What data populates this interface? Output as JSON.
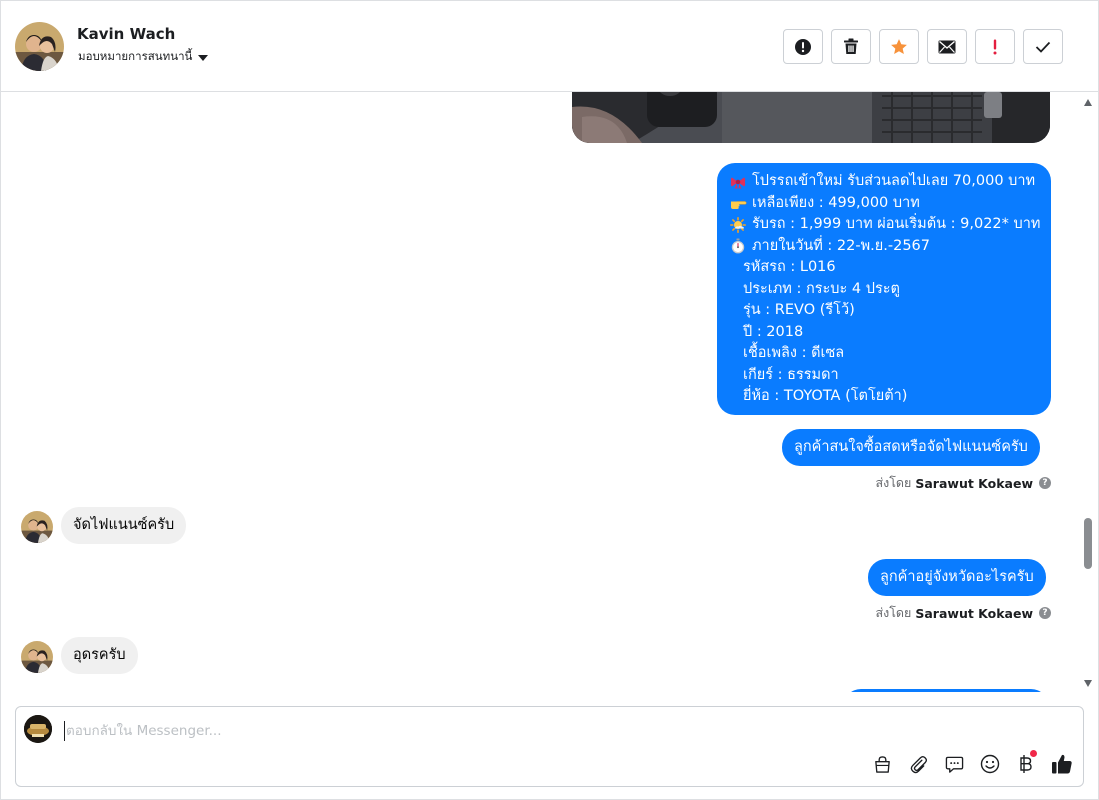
{
  "header": {
    "contact_name": "Kavin Wach",
    "assign_label": "มอบหมายการสนทนานี้",
    "actions": [
      {
        "name": "report-spam-button",
        "icon": "alert-circle-icon"
      },
      {
        "name": "delete-button",
        "icon": "trash-icon"
      },
      {
        "name": "star-button",
        "icon": "star-icon"
      },
      {
        "name": "mark-unread-button",
        "icon": "envelope-icon"
      },
      {
        "name": "follow-up-button",
        "icon": "exclamation-icon"
      },
      {
        "name": "mark-done-button",
        "icon": "check-icon"
      }
    ]
  },
  "conversation": {
    "offer_lines": [
      {
        "emoji": "ribbon-icon",
        "text": "โปรรถเข้าใหม่ รับส่วนลดไปเลย 70,000 บาท"
      },
      {
        "emoji": "pointing-hand-icon",
        "text": "เหลือเพียง : 499,000 บาท"
      },
      {
        "emoji": "sun-icon",
        "text": "รับรถ : 1,999 บาท ผ่อนเริ่มต้น : 9,022* บาท"
      },
      {
        "emoji": "stopwatch-icon",
        "text": "ภายในวันที่ : 22-พ.ย.-2567"
      },
      {
        "emoji": "",
        "text": "รหัสรถ : L016"
      },
      {
        "emoji": "",
        "text": "ประเภท : กระบะ 4 ประตู"
      },
      {
        "emoji": "",
        "text": "รุ่น : REVO (รีโว้)"
      },
      {
        "emoji": "",
        "text": "ปี : 2018"
      },
      {
        "emoji": "",
        "text": "เชื้อเพลิง : ดีเซล"
      },
      {
        "emoji": "",
        "text": "เกียร์ : ธรรมดา"
      },
      {
        "emoji": "",
        "text": "ยี่ห้อ : TOYOTA (โตโยต้า)"
      }
    ],
    "q1": "ลูกค้าสนใจซื้อสดหรือจัดไฟแนนซ์ครับ",
    "sent_by_prefix": "ส่งโดย",
    "sent_by_name": "Sarawut Kokaew",
    "reply1": "จัดไฟแนนซ์ครับ",
    "q2": "ลูกค้าอยู่จังหวัดอะไรครับ",
    "reply2": "อุดรครับ"
  },
  "composer": {
    "placeholder": "ตอบกลับใน Messenger..."
  },
  "colors": {
    "accent": "#0a7cff",
    "star": "#f7923b",
    "alert": "#e41e3f",
    "notification_dot": "#f02849"
  }
}
